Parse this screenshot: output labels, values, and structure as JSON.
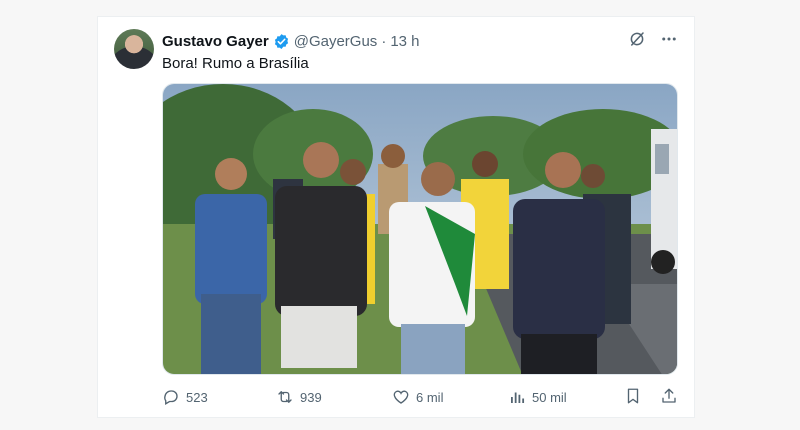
{
  "tweet": {
    "author_name": "Gustavo Gayer",
    "handle": "@GayerGus",
    "separator": "·",
    "time": "13 h",
    "text": "Bora! Rumo a Brasília",
    "media_alt": "Group of men walking along a highway"
  },
  "actions": {
    "replies": "523",
    "retweets": "939",
    "likes": "6 mil",
    "views": "50 mil"
  },
  "colors": {
    "verified": "#1d9bf0",
    "muted": "#536471",
    "text": "#0f1419"
  },
  "icons": [
    "grok-icon",
    "more-icon",
    "reply-icon",
    "retweet-icon",
    "like-icon",
    "views-icon",
    "bookmark-icon",
    "share-icon"
  ]
}
